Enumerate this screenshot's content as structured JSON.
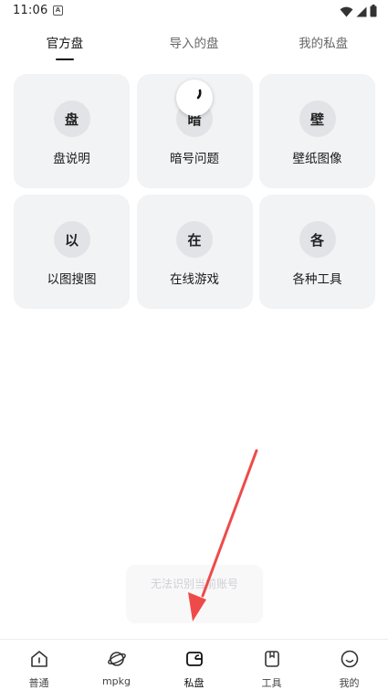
{
  "status_bar": {
    "time": "11:06",
    "app_icon_letter": "A",
    "icons": [
      "wifi-icon",
      "signal-icon",
      "battery-icon"
    ]
  },
  "tabs": [
    {
      "label": "官方盘",
      "active": true
    },
    {
      "label": "导入的盘",
      "active": false
    },
    {
      "label": "我的私盘",
      "active": false
    }
  ],
  "cards": [
    {
      "badge": "盘",
      "label": "盘说明"
    },
    {
      "badge": "暗",
      "label": "暗号问题"
    },
    {
      "badge": "壁",
      "label": "壁纸图像"
    },
    {
      "badge": "以",
      "label": "以图搜图"
    },
    {
      "badge": "在",
      "label": "在线游戏"
    },
    {
      "badge": "各",
      "label": "各种工具"
    }
  ],
  "toast": {
    "text": "无法识别当前账号"
  },
  "bottom_nav": [
    {
      "label": "普通",
      "icon": "home-icon",
      "active": false
    },
    {
      "label": "mpkg",
      "icon": "planet-icon",
      "active": false
    },
    {
      "label": "私盘",
      "icon": "wallet-icon",
      "active": true
    },
    {
      "label": "工具",
      "icon": "bookmark-icon",
      "active": false
    },
    {
      "label": "我的",
      "icon": "smile-icon",
      "active": false
    }
  ],
  "colors": {
    "accent_arrow": "#ef4a4a",
    "card_bg": "#f2f3f5",
    "badge_bg": "#e2e3e7"
  }
}
